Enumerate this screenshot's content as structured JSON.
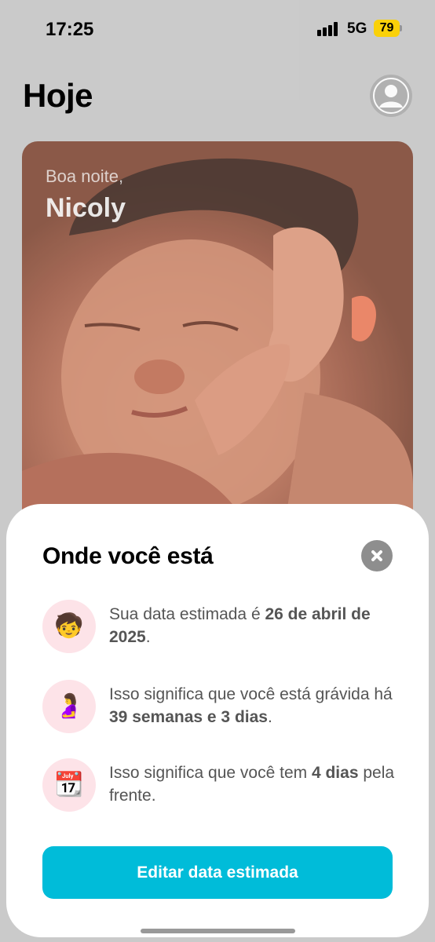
{
  "status_bar": {
    "time": "17:25",
    "network": "5G",
    "battery": "79",
    "battery_color": "#ffd60a"
  },
  "header": {
    "title": "Hoje",
    "avatar_icon": "person-icon"
  },
  "hero": {
    "greeting": "Boa noite,",
    "name": "Nicoly"
  },
  "sheet": {
    "title": "Onde você está",
    "close_icon": "close-icon",
    "rows": [
      {
        "icon": "🧒",
        "icon_name": "baby-face-icon",
        "text_before": "Sua data estimada é ",
        "text_bold": "26 de abril de 2025",
        "text_after": "."
      },
      {
        "icon": "🤰",
        "icon_name": "pregnant-woman-icon",
        "text_before": "Isso significa que você está grávida há ",
        "text_bold": "39 semanas e 3 dias",
        "text_after": "."
      },
      {
        "icon": "📆",
        "icon_name": "calendar-icon",
        "text_before": "Isso significa que você tem ",
        "text_bold": "4 dias",
        "text_after": " pela frente."
      }
    ],
    "button_label": "Editar data estimada",
    "accent_color": "#00bcd9"
  }
}
